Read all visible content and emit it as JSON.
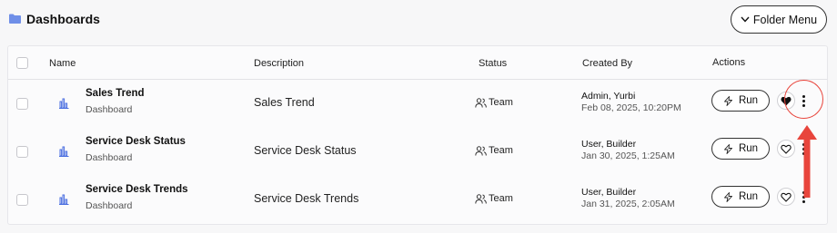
{
  "header": {
    "title": "Dashboards",
    "folder_icon": "folder-icon",
    "folder_menu_label": "Folder Menu"
  },
  "table": {
    "columns": {
      "name": "Name",
      "description": "Description",
      "status": "Status",
      "created_by": "Created By",
      "actions": "Actions"
    },
    "rows": [
      {
        "name": "Sales Trend",
        "type": "Dashboard",
        "description": "Sales Trend",
        "status": "Team",
        "creator": "Admin, Yurbi",
        "date": "Feb 08, 2025, 10:20PM",
        "run_label": "Run",
        "favorited": true
      },
      {
        "name": "Service Desk Status",
        "type": "Dashboard",
        "description": "Service Desk Status",
        "status": "Team",
        "creator": "User, Builder",
        "date": "Jan 30, 2025, 1:25AM",
        "run_label": "Run",
        "favorited": false
      },
      {
        "name": "Service Desk Trends",
        "type": "Dashboard",
        "description": "Service Desk Trends",
        "status": "Team",
        "creator": "User, Builder",
        "date": "Jan 31, 2025, 2:05AM",
        "run_label": "Run",
        "favorited": false
      }
    ]
  },
  "colors": {
    "accent_icon": "#4a6ee0",
    "annotation": "#e8453c"
  }
}
